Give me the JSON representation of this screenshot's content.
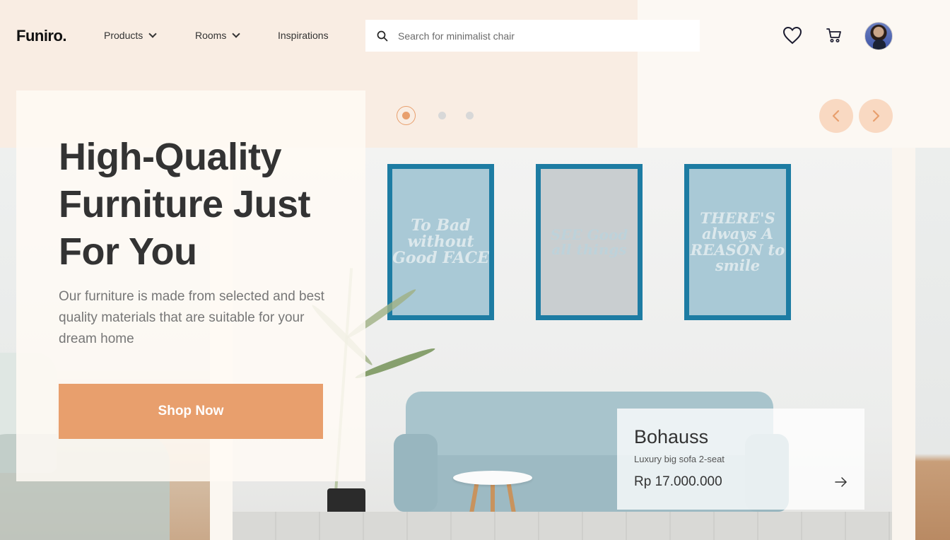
{
  "brand": {
    "logo": "Funiro."
  },
  "nav": {
    "items": [
      {
        "label": "Products",
        "has_dropdown": true
      },
      {
        "label": "Rooms",
        "has_dropdown": true
      },
      {
        "label": "Inspirations",
        "has_dropdown": false
      }
    ]
  },
  "search": {
    "placeholder": "Search for minimalist chair",
    "icon": "search-icon"
  },
  "header_actions": {
    "favorites_icon": "heart-icon",
    "cart_icon": "cart-icon",
    "avatar": "user-avatar"
  },
  "hero": {
    "title": "High-Quality Furniture Just For You",
    "description": "Our furniture is made from selected and best quality materials that are suitable for your dream home",
    "cta_label": "Shop Now"
  },
  "slider": {
    "total_slides": 3,
    "active_slide": 1,
    "prev_icon": "chevron-left-icon",
    "next_icon": "chevron-right-icon"
  },
  "artwork": {
    "frame_1": "To Bad without Good FACE",
    "frame_2": "SEE Good all things",
    "frame_3": "THERE'S always A REASON to smile"
  },
  "product": {
    "name": "Bohauss",
    "subtitle": "Luxury big sofa 2-seat",
    "price": "Rp 17.000.000",
    "arrow_icon": "arrow-right-icon"
  },
  "colors": {
    "accent": "#e89f6d",
    "accent_light": "#f9d9c2",
    "header_bg": "#f9ede3",
    "text_dark": "#333333",
    "text_muted": "#777777",
    "frame_blue": "#1d7ca3"
  }
}
